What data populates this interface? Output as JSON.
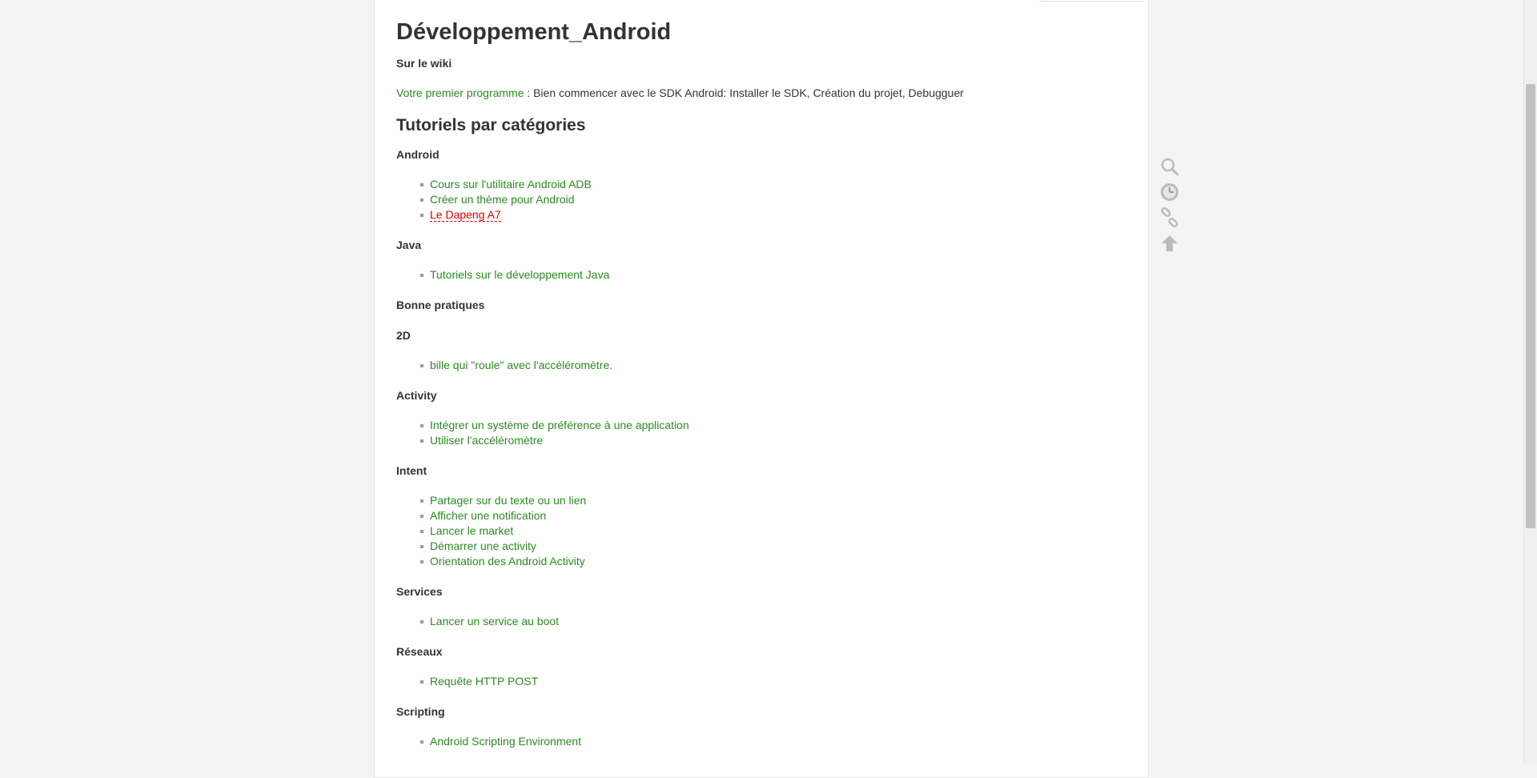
{
  "page_id": "developpement_android",
  "title": "Développement_Android",
  "wiki_section": {
    "heading": "Sur le wiki",
    "link_label": "Votre premier programme",
    "text": " : Bien commencer avec le SDK Android: Installer le SDK, Création du projet, Debugguer"
  },
  "categories_heading": "Tutoriels par catégories",
  "sections": [
    {
      "heading": "Android",
      "items": [
        {
          "label": "Cours sur l'utilitaire Android ADB",
          "missing": false
        },
        {
          "label": "Créer un thème pour Android",
          "missing": false
        },
        {
          "label": "Le Dapeng A7",
          "missing": true
        }
      ]
    },
    {
      "heading": "Java",
      "items": [
        {
          "label": "Tutoriels sur le développement Java",
          "missing": false
        }
      ]
    },
    {
      "heading": "Bonne pratiques",
      "items": []
    },
    {
      "heading": "2D",
      "items": [
        {
          "label": "bille qui \"roule\" avec l'accéléromètre.",
          "missing": false
        }
      ]
    },
    {
      "heading": "Activity",
      "items": [
        {
          "label": "Intégrer un système de préférence à une application",
          "missing": false
        },
        {
          "label": "Utiliser l'accéléromètre",
          "missing": false
        }
      ]
    },
    {
      "heading": "Intent",
      "items": [
        {
          "label": "Partager sur du texte ou un lien",
          "missing": false
        },
        {
          "label": "Afficher une notification",
          "missing": false
        },
        {
          "label": "Lancer le market",
          "missing": false
        },
        {
          "label": "Démarrer une activity",
          "missing": false
        },
        {
          "label": "Orientation des Android Activity",
          "missing": false
        }
      ]
    },
    {
      "heading": "Services",
      "items": [
        {
          "label": "Lancer un service au boot",
          "missing": false
        }
      ]
    },
    {
      "heading": "Réseaux",
      "items": [
        {
          "label": "Requête HTTP POST",
          "missing": false
        }
      ]
    },
    {
      "heading": "Scripting",
      "items": [
        {
          "label": "Android Scripting Environment",
          "missing": false
        }
      ]
    }
  ],
  "tools": [
    {
      "name": "search-icon"
    },
    {
      "name": "recent-changes-icon"
    },
    {
      "name": "backlinks-icon"
    },
    {
      "name": "back-to-top-icon"
    }
  ],
  "colors": {
    "link": "#2b8a20",
    "missing_link": "#d30000",
    "text": "#333333",
    "background": "#f4f4f4"
  }
}
